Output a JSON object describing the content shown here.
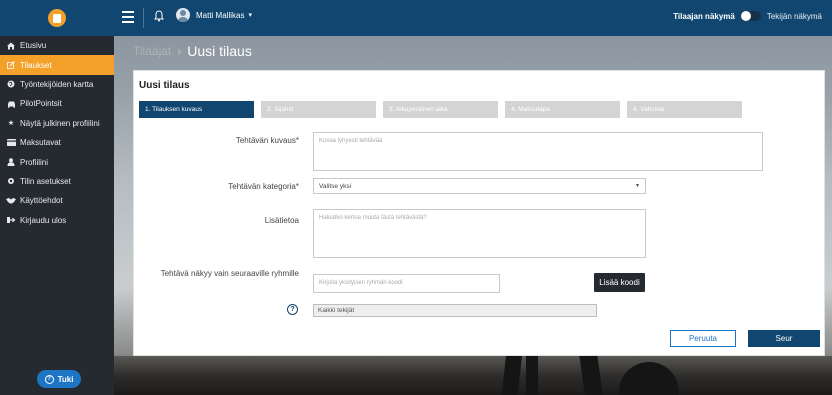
{
  "topbar": {
    "user_name": "Matti Mallikas",
    "mode_client": "Tilaajan näkymä",
    "mode_worker": "Tekijän näkymä"
  },
  "sidebar": {
    "items": [
      {
        "label": "Etusivu",
        "icon": "home-icon"
      },
      {
        "label": "Tilaukset",
        "icon": "edit-icon",
        "active": true
      },
      {
        "label": "Työntekijöiden kartta",
        "icon": "globe-icon"
      },
      {
        "label": "PilotPointsit",
        "icon": "car-icon"
      },
      {
        "label": "Näytä julkinen profiilini",
        "icon": "star-icon"
      },
      {
        "label": "Maksutavat",
        "icon": "credit-card-icon"
      },
      {
        "label": "Profiilini",
        "icon": "user-icon"
      },
      {
        "label": "Tilin asetukset",
        "icon": "gear-icon"
      },
      {
        "label": "Käyttöehdot",
        "icon": "handshake-icon"
      },
      {
        "label": "Kirjaudu ulos",
        "icon": "sign-out-icon"
      }
    ],
    "help_label": "Tuki"
  },
  "breadcrumb": {
    "parent": "Tilaajat",
    "current": "Uusi tilaus"
  },
  "form": {
    "title": "Uusi tilaus",
    "steps": [
      "1. Tilauksen kuvaus",
      "2. Sijainti",
      "3. Aikuperäinen aika",
      "4. Maksutapa",
      "4. Vahvista"
    ],
    "description_label": "Tehtävän kuvaus*",
    "description_placeholder": "Kuvaa lyhyesti tehtävää",
    "category_label": "Tehtävän kategoria*",
    "category_value": "Valitse yksi",
    "extra_label": "Lisätietoa",
    "extra_placeholder": "Haluatko kertoa muuta tästä tehtävästä?",
    "groups_label": "Tehtävä näkyy vain seuraaville ryhmille",
    "group_code_placeholder": "Kirjoita yksityisen ryhmän koodi",
    "add_code_button": "Lisää koodi",
    "groups_value": "Kaikki tekijät",
    "cancel_button": "Peruuta",
    "next_button": "Seur"
  },
  "colors": {
    "topbar": "#10466f",
    "sidebar": "#252a30",
    "accent": "#f4a12a",
    "primary": "#10466f"
  }
}
